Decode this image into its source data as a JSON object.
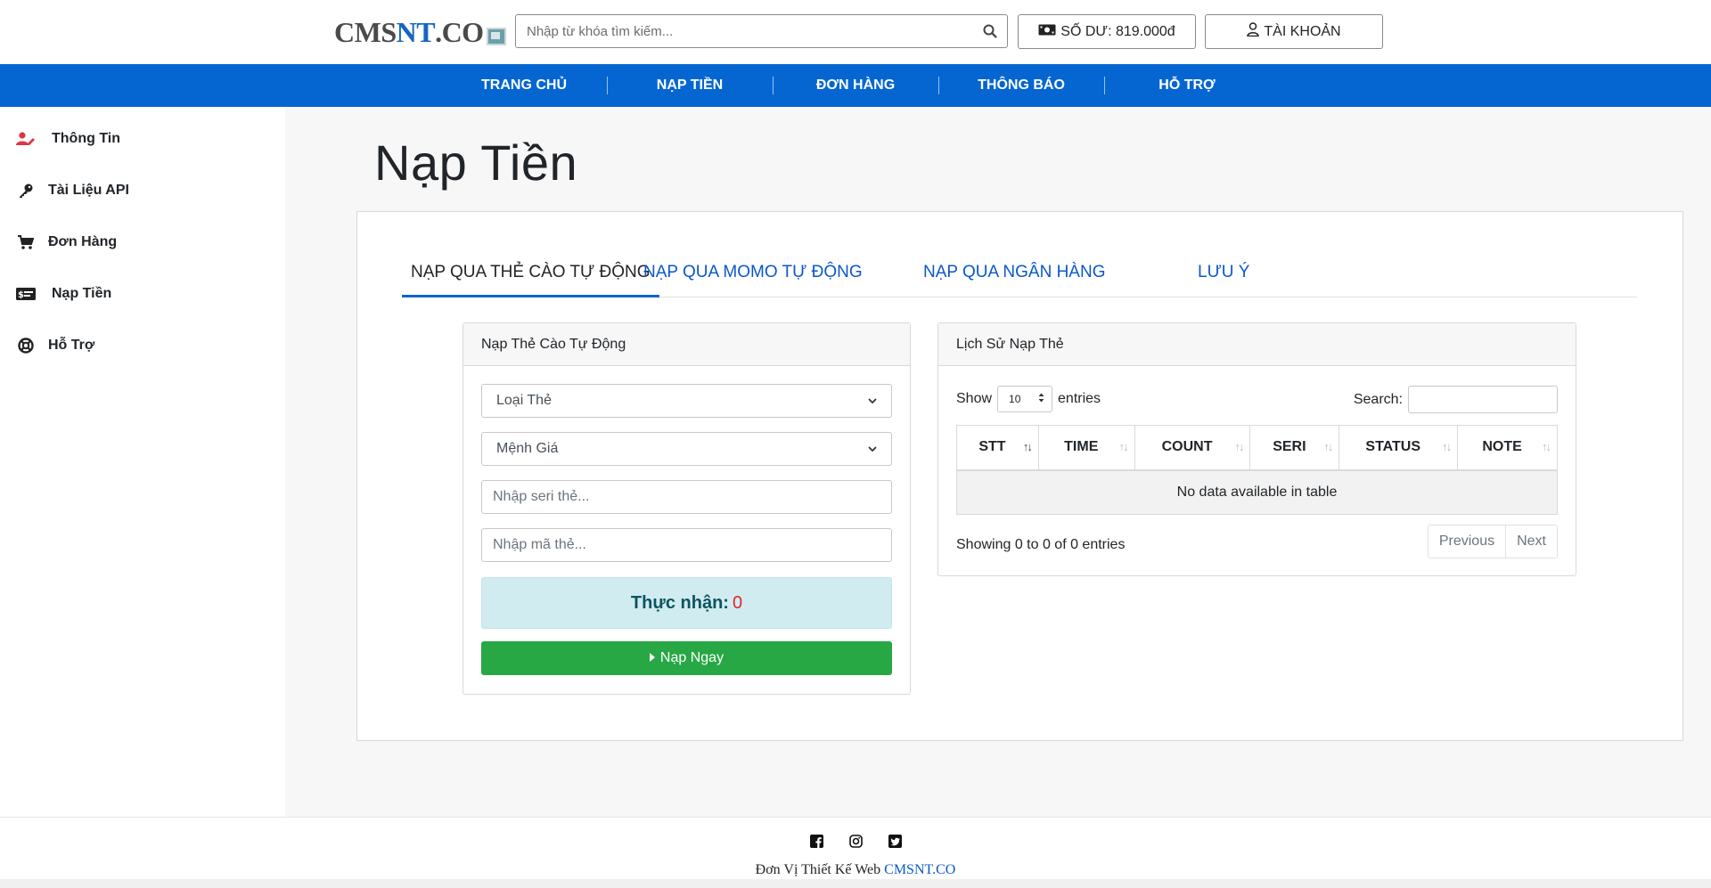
{
  "header": {
    "logo_prefix": "CMS",
    "logo_highlight": "NT",
    "logo_suffix": ".CO",
    "search_placeholder": "Nhập từ khóa tìm kiếm...",
    "balance_label": "SỐ DƯ: 819.000đ",
    "account_label": "TÀI KHOẢN"
  },
  "nav": {
    "items": [
      "TRANG CHỦ",
      "NẠP TIỀN",
      "ĐƠN HÀNG",
      "THÔNG BÁO",
      "HỖ TRỢ"
    ]
  },
  "sidebar": {
    "items": [
      {
        "label": "Thông Tin",
        "icon": "user-edit-icon"
      },
      {
        "label": "Tài Liệu API",
        "icon": "key-icon"
      },
      {
        "label": "Đơn Hàng",
        "icon": "cart-icon"
      },
      {
        "label": "Nạp Tiền",
        "icon": "money-card-icon"
      },
      {
        "label": "Hỗ Trợ",
        "icon": "lifebuoy-icon"
      }
    ]
  },
  "main": {
    "page_title": "Nạp Tiền",
    "tabs": [
      {
        "label": "NẠP QUA THẺ CÀO TỰ ĐỘNG",
        "active": true
      },
      {
        "label": "NẠP QUA MOMO TỰ ĐỘNG",
        "active": false
      },
      {
        "label": "NẠP QUA NGÂN HÀNG",
        "active": false
      },
      {
        "label": "LƯU Ý",
        "active": false
      }
    ],
    "topup_form": {
      "header": "Nạp Thẻ Cào Tự Động",
      "card_type_selected": "Loại Thẻ",
      "denomination_selected": "Mệnh Giá",
      "serial_placeholder": "Nhập seri thẻ...",
      "code_placeholder": "Nhập mã thẻ...",
      "receive_label": "Thực nhận:",
      "receive_amount": "0",
      "submit_label": "Nạp Ngay"
    },
    "history": {
      "header": "Lịch Sử Nạp Thẻ",
      "show_label": "Show",
      "page_size": "10",
      "entries_label": "entries",
      "search_label": "Search:",
      "columns": [
        "STT",
        "TIME",
        "COUNT",
        "SERI",
        "STATUS",
        "NOTE"
      ],
      "empty_message": "No data available in table",
      "info": "Showing 0 to 0 of 0 entries",
      "prev_label": "Previous",
      "next_label": "Next"
    }
  },
  "footer": {
    "credit_text": "Đơn Vị Thiết Kế Web",
    "credit_brand": "CMSNT.CO",
    "social_icons": [
      "facebook-icon",
      "instagram-icon",
      "twitter-icon"
    ]
  },
  "colors": {
    "primary": "#0566d2",
    "success": "#28a745",
    "info_bg": "#d1ecf1",
    "danger": "#e3242b",
    "sidebar_accent": "#dc3545"
  }
}
